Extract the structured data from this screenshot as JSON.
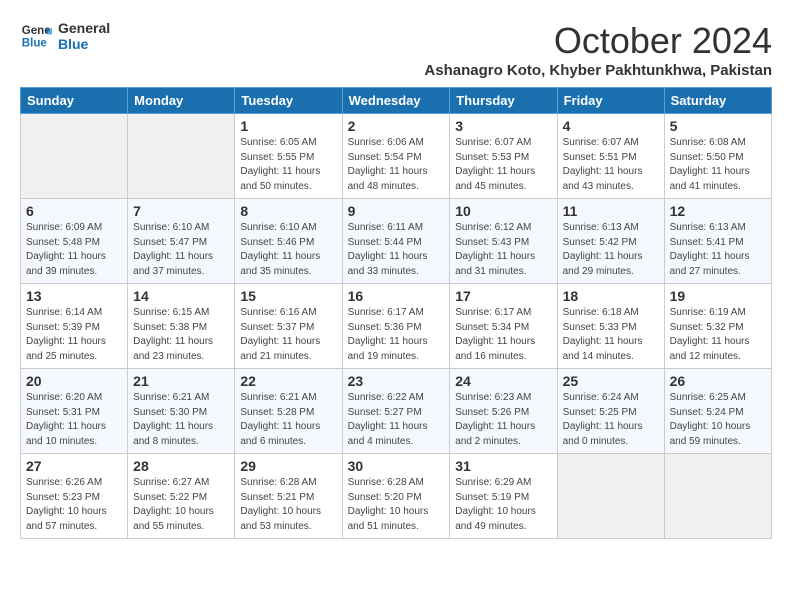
{
  "logo": {
    "line1": "General",
    "line2": "Blue"
  },
  "title": "October 2024",
  "location": "Ashanagro Koto, Khyber Pakhtunkhwa, Pakistan",
  "days_of_week": [
    "Sunday",
    "Monday",
    "Tuesday",
    "Wednesday",
    "Thursday",
    "Friday",
    "Saturday"
  ],
  "weeks": [
    [
      {
        "day": "",
        "info": ""
      },
      {
        "day": "",
        "info": ""
      },
      {
        "day": "1",
        "info": "Sunrise: 6:05 AM\nSunset: 5:55 PM\nDaylight: 11 hours and 50 minutes."
      },
      {
        "day": "2",
        "info": "Sunrise: 6:06 AM\nSunset: 5:54 PM\nDaylight: 11 hours and 48 minutes."
      },
      {
        "day": "3",
        "info": "Sunrise: 6:07 AM\nSunset: 5:53 PM\nDaylight: 11 hours and 45 minutes."
      },
      {
        "day": "4",
        "info": "Sunrise: 6:07 AM\nSunset: 5:51 PM\nDaylight: 11 hours and 43 minutes."
      },
      {
        "day": "5",
        "info": "Sunrise: 6:08 AM\nSunset: 5:50 PM\nDaylight: 11 hours and 41 minutes."
      }
    ],
    [
      {
        "day": "6",
        "info": "Sunrise: 6:09 AM\nSunset: 5:48 PM\nDaylight: 11 hours and 39 minutes."
      },
      {
        "day": "7",
        "info": "Sunrise: 6:10 AM\nSunset: 5:47 PM\nDaylight: 11 hours and 37 minutes."
      },
      {
        "day": "8",
        "info": "Sunrise: 6:10 AM\nSunset: 5:46 PM\nDaylight: 11 hours and 35 minutes."
      },
      {
        "day": "9",
        "info": "Sunrise: 6:11 AM\nSunset: 5:44 PM\nDaylight: 11 hours and 33 minutes."
      },
      {
        "day": "10",
        "info": "Sunrise: 6:12 AM\nSunset: 5:43 PM\nDaylight: 11 hours and 31 minutes."
      },
      {
        "day": "11",
        "info": "Sunrise: 6:13 AM\nSunset: 5:42 PM\nDaylight: 11 hours and 29 minutes."
      },
      {
        "day": "12",
        "info": "Sunrise: 6:13 AM\nSunset: 5:41 PM\nDaylight: 11 hours and 27 minutes."
      }
    ],
    [
      {
        "day": "13",
        "info": "Sunrise: 6:14 AM\nSunset: 5:39 PM\nDaylight: 11 hours and 25 minutes."
      },
      {
        "day": "14",
        "info": "Sunrise: 6:15 AM\nSunset: 5:38 PM\nDaylight: 11 hours and 23 minutes."
      },
      {
        "day": "15",
        "info": "Sunrise: 6:16 AM\nSunset: 5:37 PM\nDaylight: 11 hours and 21 minutes."
      },
      {
        "day": "16",
        "info": "Sunrise: 6:17 AM\nSunset: 5:36 PM\nDaylight: 11 hours and 19 minutes."
      },
      {
        "day": "17",
        "info": "Sunrise: 6:17 AM\nSunset: 5:34 PM\nDaylight: 11 hours and 16 minutes."
      },
      {
        "day": "18",
        "info": "Sunrise: 6:18 AM\nSunset: 5:33 PM\nDaylight: 11 hours and 14 minutes."
      },
      {
        "day": "19",
        "info": "Sunrise: 6:19 AM\nSunset: 5:32 PM\nDaylight: 11 hours and 12 minutes."
      }
    ],
    [
      {
        "day": "20",
        "info": "Sunrise: 6:20 AM\nSunset: 5:31 PM\nDaylight: 11 hours and 10 minutes."
      },
      {
        "day": "21",
        "info": "Sunrise: 6:21 AM\nSunset: 5:30 PM\nDaylight: 11 hours and 8 minutes."
      },
      {
        "day": "22",
        "info": "Sunrise: 6:21 AM\nSunset: 5:28 PM\nDaylight: 11 hours and 6 minutes."
      },
      {
        "day": "23",
        "info": "Sunrise: 6:22 AM\nSunset: 5:27 PM\nDaylight: 11 hours and 4 minutes."
      },
      {
        "day": "24",
        "info": "Sunrise: 6:23 AM\nSunset: 5:26 PM\nDaylight: 11 hours and 2 minutes."
      },
      {
        "day": "25",
        "info": "Sunrise: 6:24 AM\nSunset: 5:25 PM\nDaylight: 11 hours and 0 minutes."
      },
      {
        "day": "26",
        "info": "Sunrise: 6:25 AM\nSunset: 5:24 PM\nDaylight: 10 hours and 59 minutes."
      }
    ],
    [
      {
        "day": "27",
        "info": "Sunrise: 6:26 AM\nSunset: 5:23 PM\nDaylight: 10 hours and 57 minutes."
      },
      {
        "day": "28",
        "info": "Sunrise: 6:27 AM\nSunset: 5:22 PM\nDaylight: 10 hours and 55 minutes."
      },
      {
        "day": "29",
        "info": "Sunrise: 6:28 AM\nSunset: 5:21 PM\nDaylight: 10 hours and 53 minutes."
      },
      {
        "day": "30",
        "info": "Sunrise: 6:28 AM\nSunset: 5:20 PM\nDaylight: 10 hours and 51 minutes."
      },
      {
        "day": "31",
        "info": "Sunrise: 6:29 AM\nSunset: 5:19 PM\nDaylight: 10 hours and 49 minutes."
      },
      {
        "day": "",
        "info": ""
      },
      {
        "day": "",
        "info": ""
      }
    ]
  ]
}
